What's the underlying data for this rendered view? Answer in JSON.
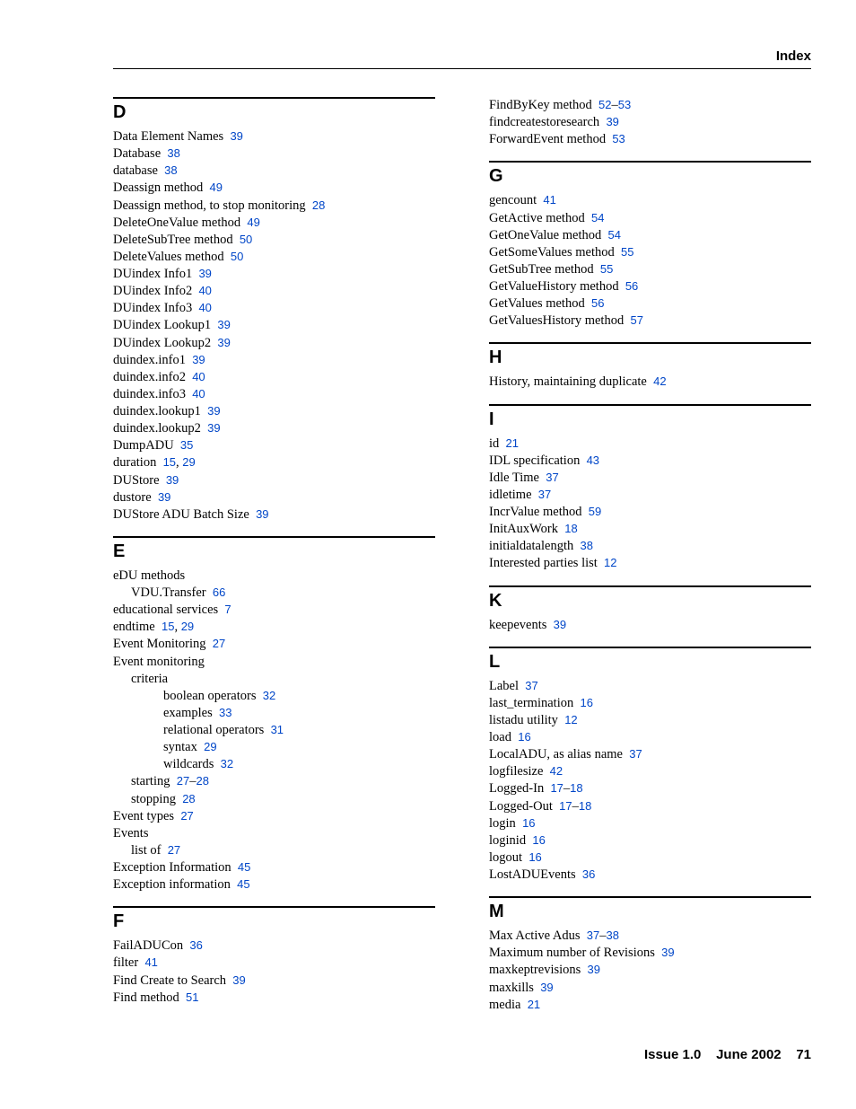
{
  "header": {
    "title": "Index"
  },
  "footer": {
    "left": "Issue 1.0",
    "mid": "June 2002",
    "page": "71"
  },
  "col1": [
    {
      "type": "heading",
      "text": "D",
      "first": true
    },
    {
      "type": "entry",
      "text": "Data Element Names",
      "pages": [
        "39"
      ]
    },
    {
      "type": "entry",
      "text": "Database",
      "pages": [
        "38"
      ]
    },
    {
      "type": "entry",
      "text": "database",
      "pages": [
        "38"
      ]
    },
    {
      "type": "entry",
      "text": "Deassign method",
      "pages": [
        "49"
      ]
    },
    {
      "type": "entry",
      "text": "Deassign method, to stop monitoring",
      "pages": [
        "28"
      ]
    },
    {
      "type": "entry",
      "text": "DeleteOneValue method",
      "pages": [
        "49"
      ]
    },
    {
      "type": "entry",
      "text": "DeleteSubTree method",
      "pages": [
        "50"
      ]
    },
    {
      "type": "entry",
      "text": "DeleteValues method",
      "pages": [
        "50"
      ]
    },
    {
      "type": "entry",
      "text": "DUindex Info1",
      "pages": [
        "39"
      ]
    },
    {
      "type": "entry",
      "text": "DUindex Info2",
      "pages": [
        "40"
      ]
    },
    {
      "type": "entry",
      "text": "DUindex Info3",
      "pages": [
        "40"
      ]
    },
    {
      "type": "entry",
      "text": "DUindex Lookup1",
      "pages": [
        "39"
      ]
    },
    {
      "type": "entry",
      "text": "DUindex Lookup2",
      "pages": [
        "39"
      ]
    },
    {
      "type": "entry",
      "text": "duindex.info1",
      "pages": [
        "39"
      ]
    },
    {
      "type": "entry",
      "text": "duindex.info2",
      "pages": [
        "40"
      ]
    },
    {
      "type": "entry",
      "text": "duindex.info3",
      "pages": [
        "40"
      ]
    },
    {
      "type": "entry",
      "text": "duindex.lookup1",
      "pages": [
        "39"
      ]
    },
    {
      "type": "entry",
      "text": "duindex.lookup2",
      "pages": [
        "39"
      ]
    },
    {
      "type": "entry",
      "text": "DumpADU",
      "pages": [
        "35"
      ]
    },
    {
      "type": "entry",
      "text": "duration",
      "pages": [
        "15",
        "29"
      ]
    },
    {
      "type": "entry",
      "text": "DUStore",
      "pages": [
        "39"
      ]
    },
    {
      "type": "entry",
      "text": "dustore",
      "pages": [
        "39"
      ]
    },
    {
      "type": "entry",
      "text": "DUStore ADU Batch Size",
      "pages": [
        "39"
      ]
    },
    {
      "type": "heading",
      "text": "E"
    },
    {
      "type": "entry",
      "text": "eDU methods"
    },
    {
      "type": "entry",
      "indent": 1,
      "text": "VDU.Transfer",
      "pages": [
        "66"
      ]
    },
    {
      "type": "entry",
      "text": "educational services",
      "pages": [
        "7"
      ]
    },
    {
      "type": "entry",
      "text": "endtime",
      "pages": [
        "15",
        "29"
      ]
    },
    {
      "type": "entry",
      "text": "Event Monitoring",
      "pages": [
        "27"
      ]
    },
    {
      "type": "entry",
      "text": "Event monitoring"
    },
    {
      "type": "entry",
      "indent": 1,
      "text": "criteria"
    },
    {
      "type": "entry",
      "indent": 2,
      "text": "boolean operators",
      "pages": [
        "32"
      ]
    },
    {
      "type": "entry",
      "indent": 2,
      "text": "examples",
      "pages": [
        "33"
      ]
    },
    {
      "type": "entry",
      "indent": 2,
      "text": "relational operators",
      "pages": [
        "31"
      ]
    },
    {
      "type": "entry",
      "indent": 2,
      "text": "syntax",
      "pages": [
        "29"
      ]
    },
    {
      "type": "entry",
      "indent": 2,
      "text": "wildcards",
      "pages": [
        "32"
      ]
    },
    {
      "type": "entry",
      "indent": 1,
      "text": "starting",
      "range": [
        "27",
        "28"
      ]
    },
    {
      "type": "entry",
      "indent": 1,
      "text": "stopping",
      "pages": [
        "28"
      ]
    },
    {
      "type": "entry",
      "text": "Event types",
      "pages": [
        "27"
      ]
    },
    {
      "type": "entry",
      "text": "Events"
    },
    {
      "type": "entry",
      "indent": 1,
      "text": "list of",
      "pages": [
        "27"
      ]
    },
    {
      "type": "entry",
      "text": "Exception Information",
      "pages": [
        "45"
      ]
    },
    {
      "type": "entry",
      "text": "Exception information",
      "pages": [
        "45"
      ]
    },
    {
      "type": "heading",
      "text": "F"
    },
    {
      "type": "entry",
      "text": "FailADUCon",
      "pages": [
        "36"
      ]
    },
    {
      "type": "entry",
      "text": "filter",
      "pages": [
        "41"
      ]
    },
    {
      "type": "entry",
      "text": "Find Create to Search",
      "pages": [
        "39"
      ]
    },
    {
      "type": "entry",
      "text": "Find method",
      "pages": [
        "51"
      ]
    }
  ],
  "col2": [
    {
      "type": "entry",
      "text": "FindByKey method",
      "range": [
        "52",
        "53"
      ]
    },
    {
      "type": "entry",
      "text": "findcreatestoresearch",
      "pages": [
        "39"
      ]
    },
    {
      "type": "entry",
      "text": "ForwardEvent method",
      "pages": [
        "53"
      ]
    },
    {
      "type": "heading",
      "text": "G"
    },
    {
      "type": "entry",
      "text": "gencount",
      "pages": [
        "41"
      ]
    },
    {
      "type": "entry",
      "text": "GetActive method",
      "pages": [
        "54"
      ]
    },
    {
      "type": "entry",
      "text": "GetOneValue method",
      "pages": [
        "54"
      ]
    },
    {
      "type": "entry",
      "text": "GetSomeValues method",
      "pages": [
        "55"
      ]
    },
    {
      "type": "entry",
      "text": "GetSubTree method",
      "pages": [
        "55"
      ]
    },
    {
      "type": "entry",
      "text": "GetValueHistory method",
      "pages": [
        "56"
      ]
    },
    {
      "type": "entry",
      "text": "GetValues method",
      "pages": [
        "56"
      ]
    },
    {
      "type": "entry",
      "text": "GetValuesHistory method",
      "pages": [
        "57"
      ]
    },
    {
      "type": "heading",
      "text": "H"
    },
    {
      "type": "entry",
      "text": "History, maintaining duplicate",
      "pages": [
        "42"
      ]
    },
    {
      "type": "heading",
      "text": "I"
    },
    {
      "type": "entry",
      "text": "id",
      "pages": [
        "21"
      ]
    },
    {
      "type": "entry",
      "text": "IDL specification",
      "pages": [
        "43"
      ]
    },
    {
      "type": "entry",
      "text": "Idle Time",
      "pages": [
        "37"
      ]
    },
    {
      "type": "entry",
      "text": "idletime",
      "pages": [
        "37"
      ]
    },
    {
      "type": "entry",
      "text": "IncrValue method",
      "pages": [
        "59"
      ]
    },
    {
      "type": "entry",
      "text": "InitAuxWork",
      "pages": [
        "18"
      ]
    },
    {
      "type": "entry",
      "text": "initialdatalength",
      "pages": [
        "38"
      ]
    },
    {
      "type": "entry",
      "text": "Interested parties list",
      "pages": [
        "12"
      ]
    },
    {
      "type": "heading",
      "text": "K"
    },
    {
      "type": "entry",
      "text": "keepevents",
      "pages": [
        "39"
      ]
    },
    {
      "type": "heading",
      "text": "L"
    },
    {
      "type": "entry",
      "text": "Label",
      "pages": [
        "37"
      ]
    },
    {
      "type": "entry",
      "text": "last_termination",
      "pages": [
        "16"
      ]
    },
    {
      "type": "entry",
      "text": "listadu utility",
      "pages": [
        "12"
      ]
    },
    {
      "type": "entry",
      "text": "load",
      "pages": [
        "16"
      ]
    },
    {
      "type": "entry",
      "text": "LocalADU, as alias name",
      "pages": [
        "37"
      ]
    },
    {
      "type": "entry",
      "text": "logfilesize",
      "pages": [
        "42"
      ]
    },
    {
      "type": "entry",
      "text": "Logged-In",
      "range": [
        "17",
        "18"
      ]
    },
    {
      "type": "entry",
      "text": "Logged-Out",
      "range": [
        "17",
        "18"
      ]
    },
    {
      "type": "entry",
      "text": "login",
      "pages": [
        "16"
      ]
    },
    {
      "type": "entry",
      "text": "loginid",
      "pages": [
        "16"
      ]
    },
    {
      "type": "entry",
      "text": "logout",
      "pages": [
        "16"
      ]
    },
    {
      "type": "entry",
      "text": "LostADUEvents",
      "pages": [
        "36"
      ]
    },
    {
      "type": "heading",
      "text": "M"
    },
    {
      "type": "entry",
      "text": "Max Active Adus",
      "range": [
        "37",
        "38"
      ]
    },
    {
      "type": "entry",
      "text": "Maximum number of Revisions",
      "pages": [
        "39"
      ]
    },
    {
      "type": "entry",
      "text": "maxkeptrevisions",
      "pages": [
        "39"
      ]
    },
    {
      "type": "entry",
      "text": "maxkills",
      "pages": [
        "39"
      ]
    },
    {
      "type": "entry",
      "text": "media",
      "pages": [
        "21"
      ]
    }
  ]
}
